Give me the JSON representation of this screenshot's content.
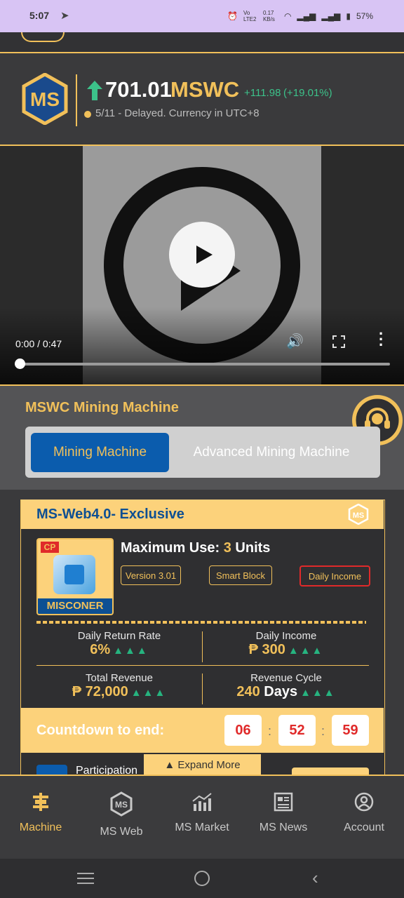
{
  "status_bar": {
    "time": "5:07",
    "network_label": "Vo LTE2",
    "speed": "0.17 KB/s",
    "battery": "57%"
  },
  "price": {
    "value": "701.01",
    "currency": "MSWC",
    "change": "+111.98",
    "change_pct": "(+19.01%)",
    "note": "5/11 - Delayed. Currency in UTC+8"
  },
  "video": {
    "time": "0:00 / 0:47",
    "progress": 0.0
  },
  "section": {
    "title": "MSWC Mining Machine",
    "tabs": [
      {
        "label": "Mining Machine",
        "active": true
      },
      {
        "label": "Advanced Mining Machine",
        "active": false
      }
    ]
  },
  "card": {
    "title": "MS-Web4.0- Exclusive",
    "product_badge": "CP",
    "product_name": "MISCONER",
    "max_use_label": "Maximum Use:",
    "max_use_value": "3",
    "max_use_unit": "Units",
    "tags": [
      "Version 3.01",
      "Smart Block",
      "Daily Income"
    ],
    "stats": [
      {
        "label": "Daily Return Rate",
        "value": "6%"
      },
      {
        "label": "Daily Income",
        "value": "₱ 300"
      },
      {
        "label": "Total Revenue",
        "value": "₱ 72,000"
      },
      {
        "label": "Revenue Cycle",
        "value_num": "240",
        "value_unit": "Days"
      }
    ],
    "countdown_label": "Countdown to end:",
    "countdown": [
      "06",
      "52",
      "59"
    ],
    "participation_label": "Participation",
    "expand_label": "▲ Expand More"
  },
  "bottom_nav": [
    {
      "label": "Machine",
      "icon": "machine-icon",
      "active": true
    },
    {
      "label": "MS Web",
      "icon": "ms-web-icon",
      "active": false
    },
    {
      "label": "MS Market",
      "icon": "market-chart-icon",
      "active": false
    },
    {
      "label": "MS News",
      "icon": "news-icon",
      "active": false
    },
    {
      "label": "Account",
      "icon": "account-icon",
      "active": false
    }
  ],
  "colors": {
    "accent": "#f1c05a",
    "brand_blue": "#0b5cad",
    "up_green": "#3cc28a",
    "countdown_red": "#e02a2a"
  }
}
